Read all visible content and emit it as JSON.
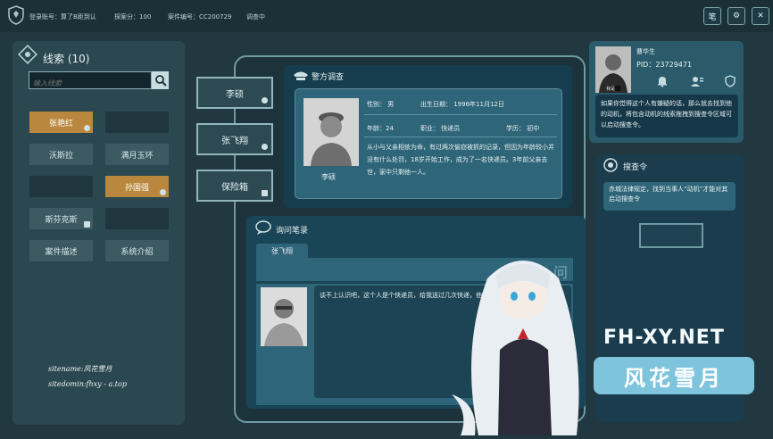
{
  "topbar": {
    "login_account": "登录账号：算了B距到认",
    "explore_score": "探案分：100",
    "case_no": "案件编号：CC200729",
    "status": "调查中",
    "buttons": [
      "笔",
      "⚙",
      "✕"
    ]
  },
  "clues": {
    "title": "线索 (10)",
    "search_placeholder": "输入线索",
    "items": [
      "张艳红",
      "",
      "沃斯拉",
      "满月玉环",
      "",
      "孙国强",
      "斯芬克斯",
      "",
      "案件描述",
      "系统介绍"
    ]
  },
  "site_info": {
    "sitename": "sitename:风花雪月",
    "sitedomain": "sitedomin:fhxy - a.top"
  },
  "persons": [
    "李硕",
    "张飞翔",
    "保险箱"
  ],
  "police": {
    "title": "警方调查",
    "photo_name": "李硕",
    "sex": "性别：  男",
    "birth": "出生日期：  1996年11月12日",
    "age": "年龄：24",
    "job": "职业：  快递员",
    "edu": "学历：  初中",
    "bio": "从小与父亲相依为命，有过两次偷窃被抓的记录，但因为年龄较小并没有什么处罚，18岁开始工作，成为了一名快递员。3年前父亲去世，家中只剩他一人。"
  },
  "inquiry": {
    "title": "询问笔录",
    "tab": "张飞翔",
    "bar_text": "问",
    "text": "谈不上认识吧，这个人是个快递员，给我送过几次快递，他。"
  },
  "profile": {
    "name": "曹华生",
    "pid": "PID：23729471",
    "avatar_label": "我是",
    "bubble": "如果你觉得这个人有嫌疑的话，那么就去找到他的动机，将包含动机的线索拖拽到搜查令区域可以启动搜查令。"
  },
  "warrant": {
    "title": "搜查令",
    "text": "赤城法律规定，找到当事人“动机”才能对其启动搜查令"
  },
  "watermark": {
    "url": "FH-XY.NET",
    "logo": "风花雪月"
  }
}
